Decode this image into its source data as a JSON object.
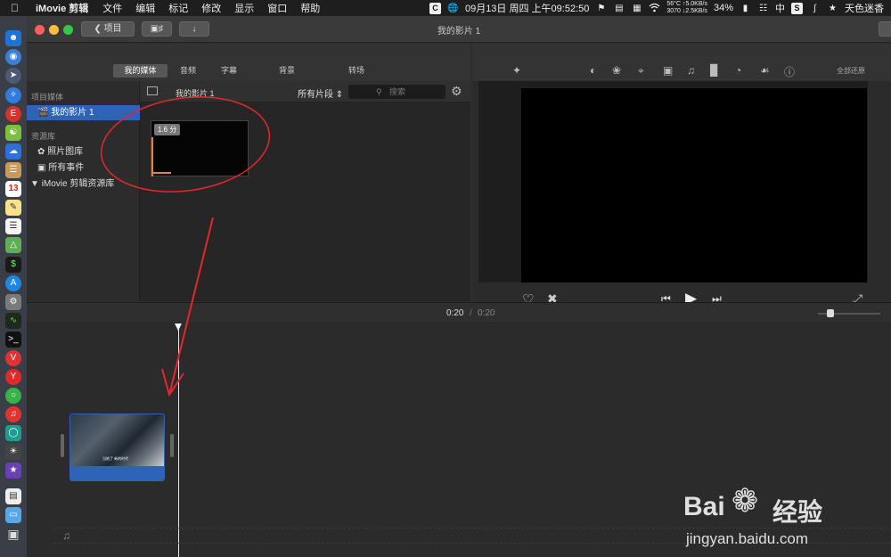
{
  "menubar": {
    "app_name": "iMovie 剪辑",
    "menus": [
      "文件",
      "编辑",
      "标记",
      "修改",
      "显示",
      "窗口",
      "帮助"
    ],
    "datetime": "09月13日 周四 上午09:52:50",
    "net_temp": "56°C",
    "net_up": "↑5.0KB/s",
    "net_rpm": "3070",
    "net_down": "↓2.5KB/s",
    "battery": "34%",
    "input_method": "中",
    "user": "天色迷香"
  },
  "titlebar": {
    "back_label": "项目",
    "window_title": "我的影片 1"
  },
  "tabs": [
    "我的媒体",
    "音频",
    "字幕",
    "背景",
    "转场"
  ],
  "sidebar": {
    "project_head": "项目媒体",
    "project_item": "我的影片 1",
    "library_head": "资源库",
    "items": [
      "照片图库",
      "所有事件"
    ],
    "library_name": "iMovie 剪辑资源库"
  },
  "browser": {
    "title": "我的影片 1",
    "filter": "所有片段",
    "search_placeholder": "搜索",
    "clip_duration": "1.6 分"
  },
  "viewer": {
    "reset_all": "全部还原"
  },
  "timeline": {
    "current_time": "0:20",
    "separator": "/",
    "total_time": "0:20",
    "clip_subtitle": "当地了 新的时代"
  },
  "watermark": {
    "brand_prefix": "Bai",
    "brand_suffix": "经验",
    "url": "jingyan.baidu.com"
  },
  "colors": {
    "selection": "#2f63b8",
    "annotation": "#e5262b",
    "clip_audio": "#2f63b8",
    "progress": "#e8823a"
  }
}
